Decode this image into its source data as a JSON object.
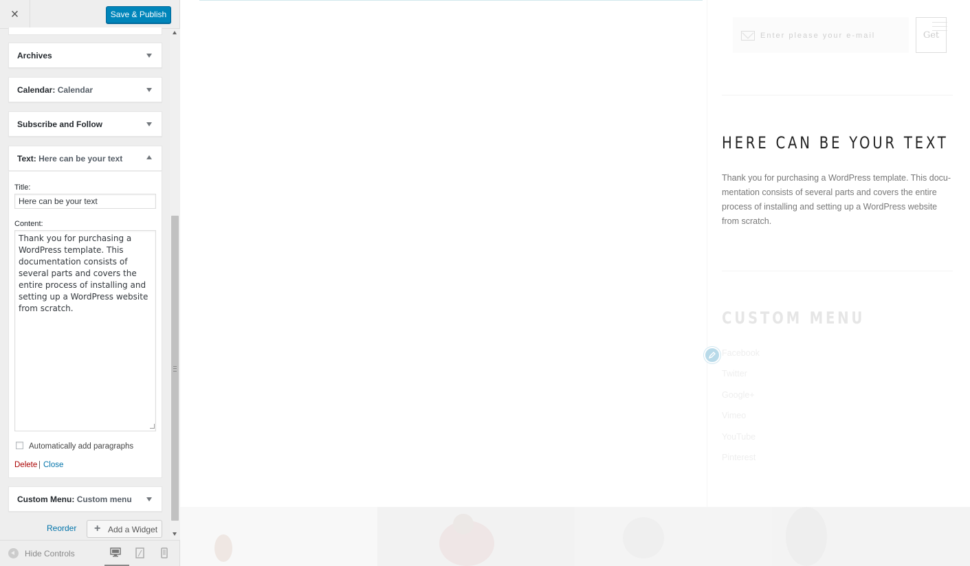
{
  "sidebar": {
    "close_glyph": "×",
    "publish_label": "Save & Publish",
    "widgets": [
      {
        "title": "Archives",
        "subtitle": ""
      },
      {
        "title": "Calendar",
        "subtitle": "Calendar"
      },
      {
        "title": "Subscribe and Follow",
        "subtitle": ""
      },
      {
        "title": "Text",
        "subtitle": "Here can be your text"
      },
      {
        "title": "Custom Menu",
        "subtitle": "Custom menu"
      }
    ],
    "text_widget": {
      "title_label": "Title:",
      "title_value": "Here can be your text",
      "content_label": "Content:",
      "content_value": "Thank you for purchasing a WordPress template. This documentation consists of several parts and covers the entire process of installing and setting up a WordPress website from scratch.",
      "auto_paragraphs_label": "Automatically add paragraphs",
      "auto_paragraphs_checked": false,
      "delete_label": "Delete",
      "separator": "|",
      "close_label": "Close"
    },
    "reorder_label": "Reorder",
    "add_widget_label": "Add a Widget",
    "footer": {
      "hide_controls_label": "Hide Controls",
      "active_device": "desktop"
    }
  },
  "preview": {
    "email_placeholder": "Enter please your e-mail",
    "get_label": "Get",
    "text_widget_heading": "HERE CAN BE YOUR TEXT",
    "text_widget_body": "Thank you for purchasing a WordPress template. This docu-mentation consists of several parts and covers the entire process of installing and setting up a WordPress website from scratch.",
    "custom_menu_heading": "CUSTOM MENU",
    "custom_menu_items": [
      "Facebook",
      "Twitter",
      "Google+",
      "Vimeo",
      "YouTube",
      "Pinterest"
    ]
  },
  "colors": {
    "publish_bg": "#0085ba",
    "link": "#0073aa",
    "delete": "#a00000",
    "edit_shortcut": "#b8dae9"
  }
}
